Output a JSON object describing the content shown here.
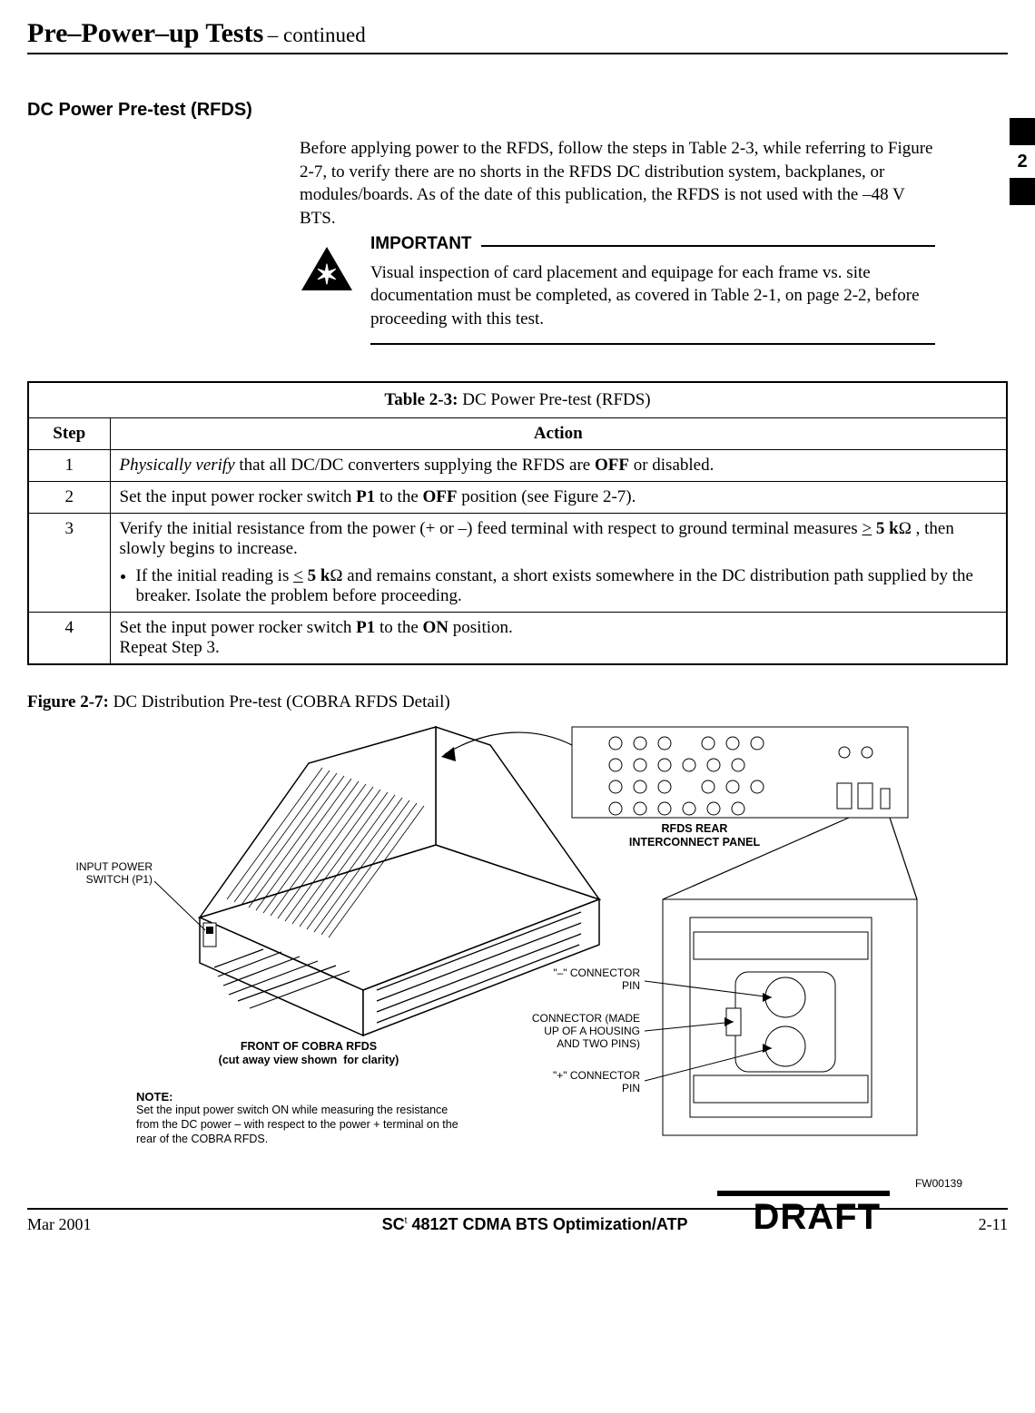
{
  "header": {
    "title": "Pre–Power–up Tests",
    "continued": " – continued"
  },
  "sidebar": {
    "tab_number": "2"
  },
  "section_heading": "DC Power Pre-test (RFDS)",
  "intro_para": "Before applying power to the RFDS, follow the steps in Table 2-3, while referring to Figure 2-7, to verify there are no shorts in the RFDS DC distribution system, backplanes, or modules/boards. As of the date of this publication, the RFDS is not used with the –48 V BTS.",
  "important": {
    "label": "IMPORTANT",
    "text": "Visual inspection of card placement and equipage for each frame vs. site documentation must be completed, as covered in Table 2-1, on page 2-2, before proceeding with this test."
  },
  "table": {
    "caption_prefix": "Table 2-3:",
    "caption_text": " DC Power Pre-test (RFDS)",
    "col_step": "Step",
    "col_action": "Action",
    "rows": [
      {
        "step": "1",
        "action_html": "<i>Physically verify</i> that all DC/DC converters supplying the RFDS are <b>OFF</b> or disabled."
      },
      {
        "step": "2",
        "action_html": "Set the input power rocker switch <b>P1</b> to the <b>OFF</b> position (see Figure 2-7)."
      },
      {
        "step": "3",
        "action_html": "Verify the initial resistance from the power (+ or –) feed terminal with respect to ground terminal measures <u>&gt;</u> <b>5 k</b>Ω , then slowly begins to increase.",
        "bullet_html": "If the initial reading is <u>&lt;</u> <b>5 k</b>Ω and remains constant, a short exists somewhere in the DC distribution path supplied by the breaker. Isolate the problem before proceeding."
      },
      {
        "step": "4",
        "action_html": "Set the input power rocker switch <b>P1</b> to the <b>ON</b> position.",
        "extra_html": "Repeat Step 3."
      }
    ]
  },
  "figure": {
    "caption_prefix": "Figure 2-7:",
    "caption_text": " DC Distribution Pre-test (COBRA RFDS Detail)",
    "input_power_label": "INPUT POWER\nSWITCH (P1)",
    "front_label": "FRONT OF COBRA RFDS\n(cut away view shown  for clarity)",
    "note_head": "NOTE:",
    "note_body": "Set the input power switch ON while measuring the resistance from the DC power –  with respect to the power + terminal on the rear of the COBRA RFDS.",
    "rear_panel_label": "RFDS REAR\nINTERCONNECT PANEL",
    "neg_pin": "\"–\" CONNECTOR\nPIN",
    "connector_made": "CONNECTOR (MADE\nUP OF A HOUSING\nAND TWO PINS)",
    "pos_pin": "\"+\" CONNECTOR\nPIN",
    "fwid": "FW00139"
  },
  "footer": {
    "date": "Mar 2001",
    "doc_title": "4812T CDMA BTS Optimization/ATP",
    "sc_prefix": "SC",
    "tm": "t",
    "page": "2-11",
    "draft": "DRAFT"
  }
}
